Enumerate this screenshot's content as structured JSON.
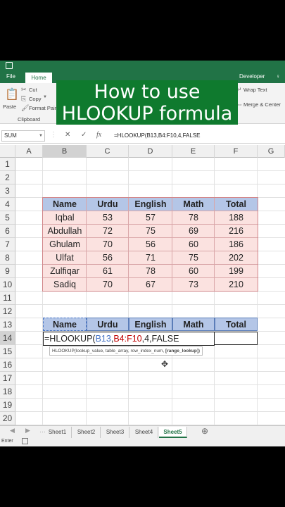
{
  "ribbon": {
    "tabs": {
      "file": "File",
      "home": "Home",
      "developer": "Developer"
    },
    "clipboard": {
      "paste": "Paste",
      "cut": "Cut",
      "copy": "Copy",
      "format_painter": "Format Pain",
      "group": "Clipboard"
    },
    "right": {
      "wrap_text": "Wrap Text",
      "merge_center": "Merge & Center"
    }
  },
  "overlay": {
    "line1": "How to use",
    "line2": "HLOOKUP formula"
  },
  "formula_bar": {
    "name_box": "SUM",
    "formula": "=HLOOKUP(B13,B4:F10,4,FALSE"
  },
  "columns": [
    "A",
    "B",
    "C",
    "D",
    "E",
    "F",
    "G"
  ],
  "rows": [
    "1",
    "2",
    "3",
    "4",
    "5",
    "6",
    "7",
    "8",
    "9",
    "10",
    "11",
    "12",
    "13",
    "14",
    "15",
    "16",
    "17",
    "18",
    "19",
    "20"
  ],
  "table": {
    "headers": [
      "Name",
      "Urdu",
      "English",
      "Math",
      "Total"
    ],
    "rows": [
      [
        "Iqbal",
        "53",
        "57",
        "78",
        "188"
      ],
      [
        "Abdullah",
        "72",
        "75",
        "69",
        "216"
      ],
      [
        "Ghulam",
        "70",
        "56",
        "60",
        "186"
      ],
      [
        "Ulfat",
        "56",
        "71",
        "75",
        "202"
      ],
      [
        "Zulfiqar",
        "61",
        "78",
        "60",
        "199"
      ],
      [
        "Sadiq",
        "70",
        "67",
        "73",
        "210"
      ]
    ]
  },
  "lookup_table": {
    "headers": [
      "Name",
      "Urdu",
      "English",
      "Math",
      "Total"
    ]
  },
  "edit_cell": {
    "fn": "=HLOOKUP(",
    "ref1": "B13",
    "sep1": ",",
    "ref2": "B4:F10",
    "rest": ",4,FALSE"
  },
  "tooltip": {
    "text": "HLOOKUP(lookup_value, table_array, row_index_num, ",
    "bold": "[range_lookup]",
    "close": ")"
  },
  "sheets": [
    "Sheet1",
    "Sheet2",
    "Sheet3",
    "Sheet4",
    "Sheet5"
  ],
  "active_sheet": "Sheet5",
  "status": {
    "mode": "Enter"
  },
  "colors": {
    "excel_green": "#217346",
    "overlay_green": "#0f7a2e",
    "header_blue": "#b4c6e7",
    "data_pink": "#fbe2e0",
    "ref_blue": "#4472c4",
    "ref_red": "#c00000"
  }
}
